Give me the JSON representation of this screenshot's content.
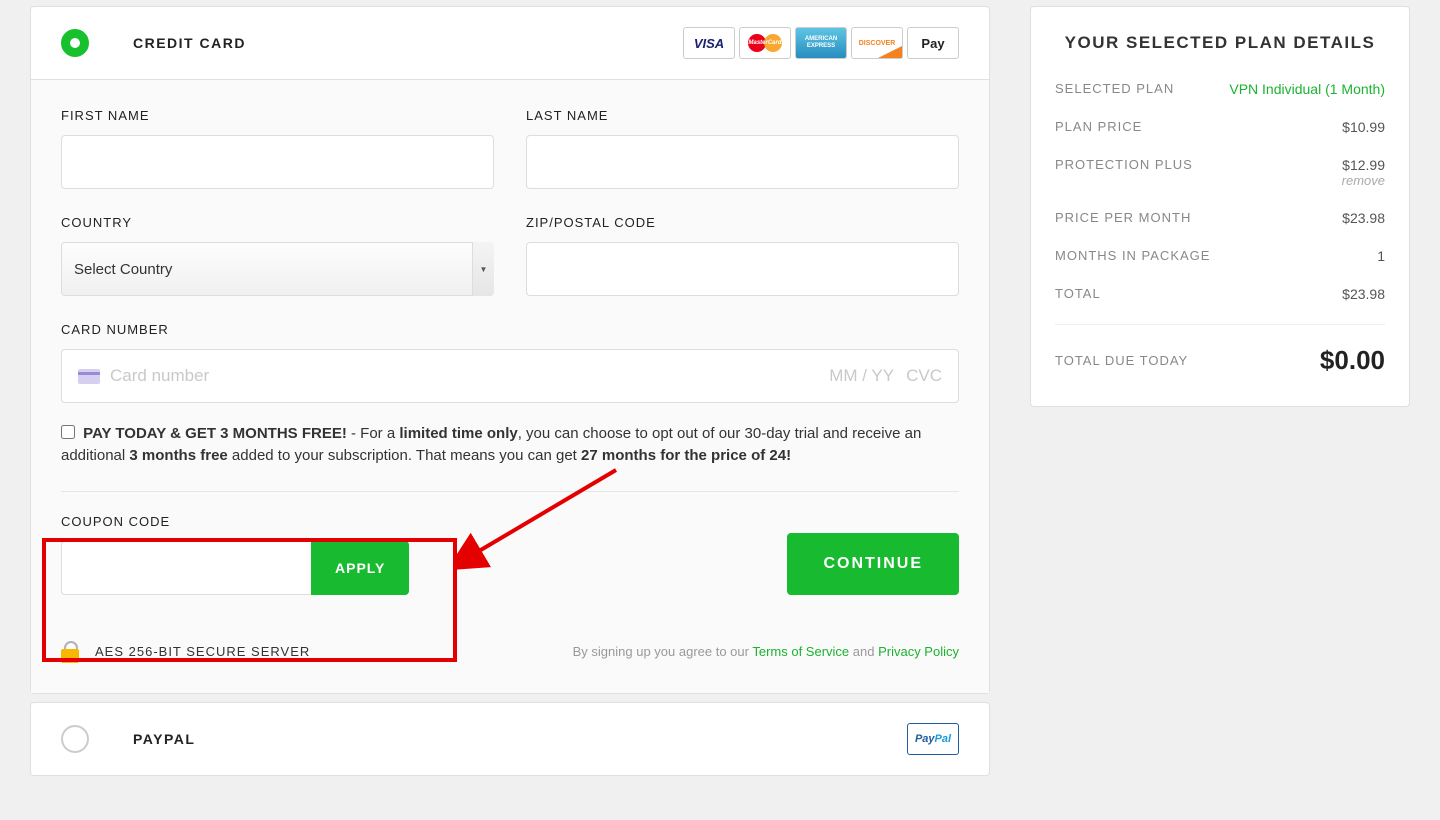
{
  "credit_card": {
    "title": "CREDIT CARD",
    "fields": {
      "first_name_label": "FIRST NAME",
      "last_name_label": "LAST NAME",
      "country_label": "COUNTRY",
      "country_placeholder": "Select Country",
      "zip_label": "ZIP/POSTAL CODE",
      "card_label": "CARD NUMBER",
      "card_placeholder": "Card number",
      "mmyy": "MM / YY",
      "cvc": "CVC"
    },
    "offer": {
      "bold_lead": "PAY TODAY & GET 3 MONTHS FREE!",
      "part1": " - For a ",
      "bold_limited": "limited time only",
      "part2": ", you can choose to opt out of our 30-day trial and receive an additional ",
      "bold_months": "3 months free",
      "part3": " added to your subscription. That means you can get ",
      "bold_price": "27 months for the price of 24!"
    },
    "coupon_label": "COUPON CODE",
    "apply": "APPLY",
    "continue": "CONTINUE",
    "secure": "AES 256-BIT SECURE SERVER",
    "legal_prefix": "By signing up you agree to our ",
    "tos": "Terms of Service",
    "and": " and ",
    "privacy": "Privacy Policy"
  },
  "paypal": {
    "title": "PAYPAL"
  },
  "summary": {
    "title": "YOUR SELECTED PLAN DETAILS",
    "rows": {
      "selected_plan_label": "SELECTED PLAN",
      "selected_plan_value": "VPN Individual (1 Month)",
      "plan_price_label": "PLAN PRICE",
      "plan_price_value": "$10.99",
      "protection_label": "PROTECTION PLUS",
      "protection_value": "$12.99",
      "remove": "remove",
      "ppm_label": "PRICE PER MONTH",
      "ppm_value": "$23.98",
      "months_label": "MONTHS IN PACKAGE",
      "months_value": "1",
      "total_label": "TOTAL",
      "total_value": "$23.98",
      "due_label": "TOTAL DUE TODAY",
      "due_value": "$0.00"
    }
  }
}
